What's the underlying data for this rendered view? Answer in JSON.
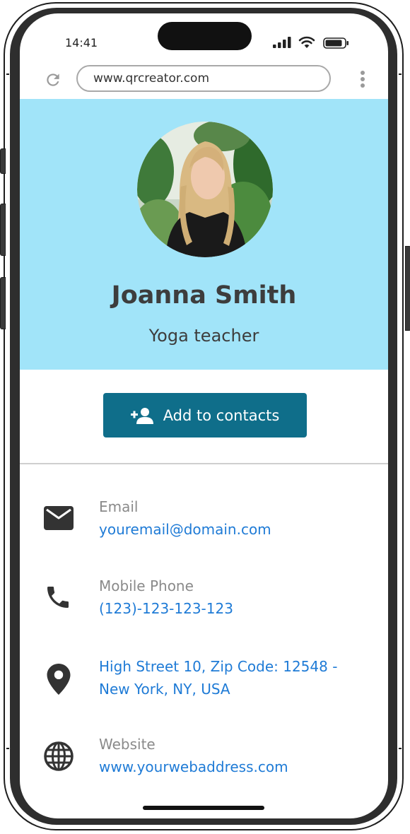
{
  "status_bar": {
    "time": "14:41"
  },
  "browser": {
    "url": "www.qrcreator.com"
  },
  "profile": {
    "name": "Joanna Smith",
    "title": "Yoga teacher"
  },
  "actions": {
    "add_contact_label": "Add to contacts"
  },
  "contacts": {
    "email": {
      "label": "Email",
      "value": "youremail@domain.com",
      "icon": "mail-icon"
    },
    "phone": {
      "label": "Mobile Phone",
      "value": "(123)-123-123-123",
      "icon": "phone-icon"
    },
    "address": {
      "line1": "High Street 10, Zip Code: 12548 -",
      "line2": "New York, NY, USA",
      "icon": "location-pin-icon"
    },
    "website": {
      "label": "Website",
      "value": "www.yourwebaddress.com",
      "icon": "globe-icon"
    }
  },
  "colors": {
    "hero_background": "#a1e4f9",
    "button_background": "#0f6e8a",
    "link": "#1f7bd6",
    "label": "#8a8a8a",
    "heading": "#3d3d3d"
  }
}
